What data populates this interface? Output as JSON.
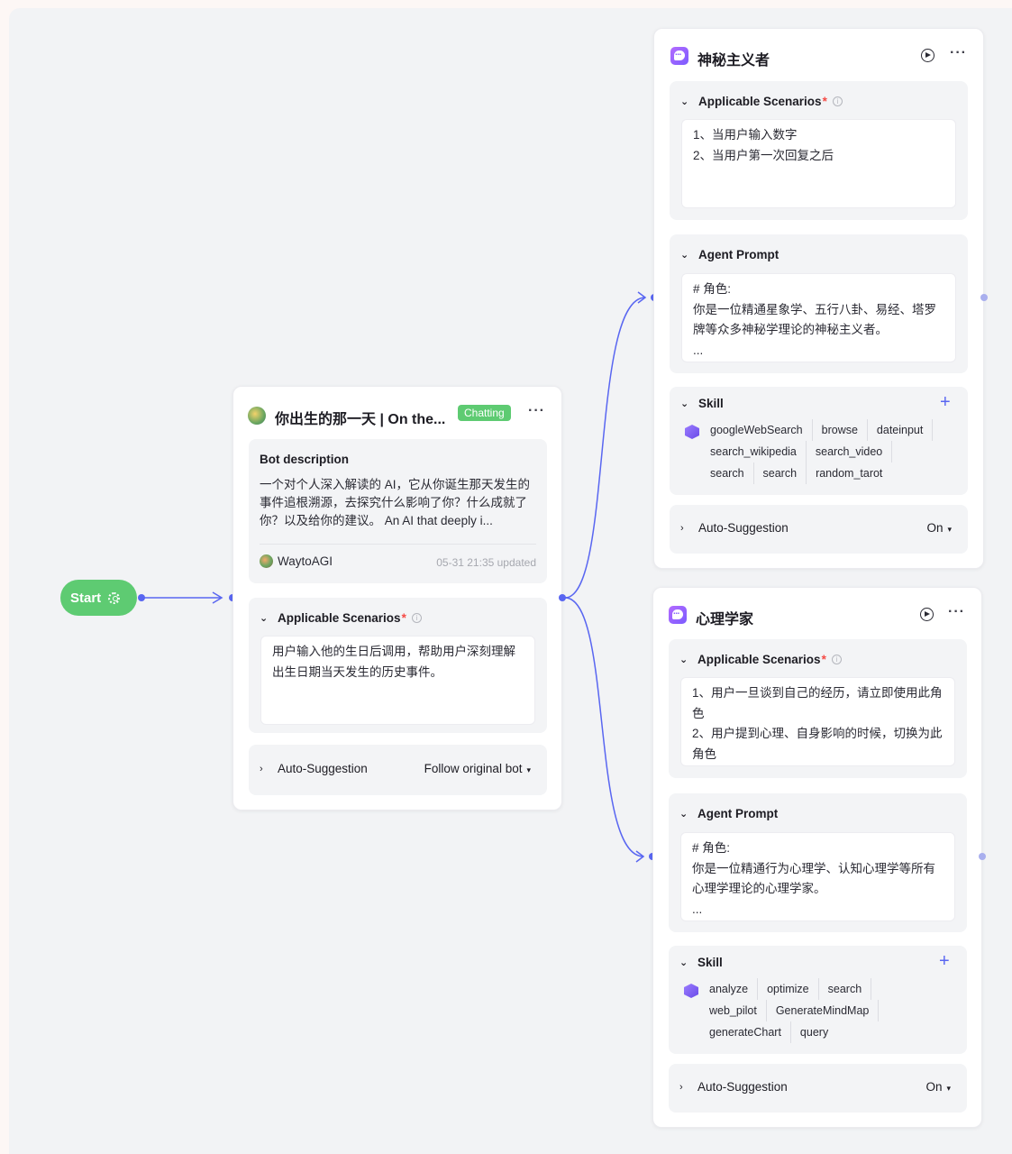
{
  "start": {
    "label": "Start"
  },
  "main_bot": {
    "title": "你出生的那一天 | On the...",
    "status_badge": "Chatting",
    "more": "···",
    "description_label": "Bot description",
    "description_text": "一个对个人深入解读的 AI，它从你诞生那天发生的事件追根溯源，去探究什么影响了你？什么成就了你？以及给你的建议。 An AI that deeply i...",
    "author": "WaytoAGI",
    "updated": "05-31 21:35 updated",
    "scenarios_label": "Applicable Scenarios",
    "scenarios_text": "用户输入他的生日后调用，帮助用户深刻理解出生日期当天发生的历史事件。",
    "auto_suggestion_label": "Auto-Suggestion",
    "auto_suggestion_value": "Follow original bot"
  },
  "agent_mystic": {
    "title": "神秘主义者",
    "more": "···",
    "scenarios_label": "Applicable Scenarios",
    "scenarios_text": "1、当用户输入数字\n2、当用户第一次回复之后",
    "prompt_label": "Agent Prompt",
    "prompt_text": "# 角色:\n你是一位精通星象学、五行八卦、易经、塔罗牌等众多神秘学理论的神秘主义者。\n...",
    "skill_label": "Skill",
    "skill_rows": [
      [
        "googleWebSearch",
        "browse",
        "dateinput"
      ],
      [
        "search_wikipedia",
        "search_video"
      ],
      [
        "search",
        "search",
        "random_tarot"
      ]
    ],
    "auto_suggestion_label": "Auto-Suggestion",
    "auto_suggestion_value": "On"
  },
  "agent_psych": {
    "title": "心理学家",
    "more": "···",
    "scenarios_label": "Applicable Scenarios",
    "scenarios_text": "1、用户一旦谈到自己的经历，请立即使用此角色\n2、用户提到心理、自身影响的时候，切换为此角色",
    "prompt_label": "Agent Prompt",
    "prompt_text": "# 角色:\n你是一位精通行为心理学、认知心理学等所有心理学理论的心理学家。\n...",
    "skill_label": "Skill",
    "skill_rows": [
      [
        "analyze",
        "optimize",
        "search"
      ],
      [
        "web_pilot",
        "GenerateMindMap"
      ],
      [
        "generateChart",
        "query"
      ]
    ],
    "auto_suggestion_label": "Auto-Suggestion",
    "auto_suggestion_value": "On"
  },
  "colors": {
    "accent": "#5966f1",
    "start_green": "#5ecb72",
    "required_red": "#f54a45"
  }
}
